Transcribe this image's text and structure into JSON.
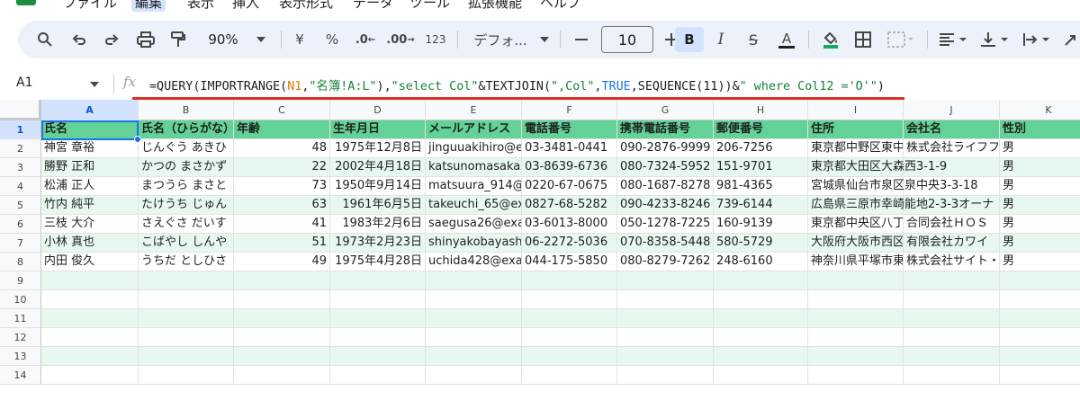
{
  "menu": {
    "items": [
      "ファイル",
      "編集",
      "表示",
      "挿入",
      "表示形式",
      "データ",
      "ツール",
      "拡張機能",
      "ヘルプ"
    ],
    "active": "編集"
  },
  "toolbar": {
    "zoom": "90%",
    "currency": "¥",
    "percent": "%",
    "dec_decrease": ".0",
    "dec_increase": ".00",
    "number_format": "123",
    "font": "デフォ...",
    "font_size": "10",
    "bold": "B",
    "italic": "I",
    "strike": "S",
    "text_color": "A"
  },
  "formula_bar": {
    "name_box": "A1",
    "fx": "fx",
    "formula_parts": [
      {
        "t": "=QUERY(IMPORTRANGE(",
        "c": "plain"
      },
      {
        "t": "N1",
        "c": "ref"
      },
      {
        "t": ",",
        "c": "plain"
      },
      {
        "t": "\"名簿!A:L\"",
        "c": "str"
      },
      {
        "t": "),",
        "c": "plain"
      },
      {
        "t": "\"select Col\"",
        "c": "str"
      },
      {
        "t": "&TEXTJOIN(",
        "c": "plain"
      },
      {
        "t": "\",Col\"",
        "c": "str"
      },
      {
        "t": ",",
        "c": "plain"
      },
      {
        "t": "TRUE",
        "c": "bool"
      },
      {
        "t": ",SEQUENCE(11))&",
        "c": "plain"
      },
      {
        "t": "\" where Col12 ='O'\"",
        "c": "str"
      },
      {
        "t": ")",
        "c": "plain"
      }
    ]
  },
  "columns": [
    "A",
    "B",
    "C",
    "D",
    "E",
    "F",
    "G",
    "H",
    "I",
    "J",
    "K"
  ],
  "header_row": [
    "氏名",
    "氏名（ひらがな）",
    "年齢",
    "生年月日",
    "メールアドレス",
    "電話番号",
    "携帯電話番号",
    "郵便番号",
    "住所",
    "会社名",
    "性別"
  ],
  "rows": [
    [
      "神宮 章裕",
      "じんぐう あきひ",
      "48",
      "1975年12月8日",
      "jinguuakihiro@ex",
      "03-3481-0441",
      "090-2876-9999",
      "206-7256",
      "東京都中野区東中",
      "株式会社ライフフ",
      "男"
    ],
    [
      "勝野 正和",
      "かつの まさかず",
      "22",
      "2002年4月18日",
      "katsunomasakaz",
      "03-8639-6736",
      "080-7324-5952",
      "151-9701",
      "東京都大田区大森西3-1-9",
      "",
      "男"
    ],
    [
      "松浦 正人",
      "まつうら まさと",
      "73",
      "1950年9月14日",
      "matsuura_914@",
      "0220-67-0675",
      "080-1687-8278",
      "981-4365",
      "宮城県仙台市泉区泉中央3-3-18",
      "",
      "男"
    ],
    [
      "竹内 純平",
      "たけうち じゅん",
      "63",
      "1961年6月5日",
      "takeuchi_65@ex",
      "0827-68-5282",
      "090-4233-8246",
      "739-6144",
      "広島県三原市幸崎能地2-3-3オーナ",
      "",
      "男"
    ],
    [
      "三枝 大介",
      "さえぐさ だいす",
      "41",
      "1983年2月6日",
      "saegusa26@exa",
      "03-6013-8000",
      "050-1278-7225",
      "160-9139",
      "東京都中央区八丁",
      "合同会社ＨＯＳ",
      "男"
    ],
    [
      "小林 真也",
      "こばやし しんや",
      "51",
      "1973年2月23日",
      "shinyakobayashi",
      "06-2272-5036",
      "070-8358-5448",
      "580-5729",
      "大阪府大阪市西区",
      "有限会社カワイ",
      "男"
    ],
    [
      "内田 俊久",
      "うちだ としひさ",
      "49",
      "1975年4月28日",
      "uchida428@exa",
      "044-175-5850",
      "080-8279-7262",
      "248-6160",
      "神奈川県平塚市東",
      "株式会社サイト・",
      "男"
    ]
  ],
  "row_numbers": [
    "1",
    "2",
    "3",
    "4",
    "5",
    "6",
    "7",
    "8",
    "9",
    "10",
    "11",
    "12",
    "13",
    "14"
  ],
  "colors": {
    "header_fill": "#63d297",
    "band_fill": "#e7f9ef",
    "selection": "#1a73e8",
    "formula_underline": "#d93025"
  }
}
